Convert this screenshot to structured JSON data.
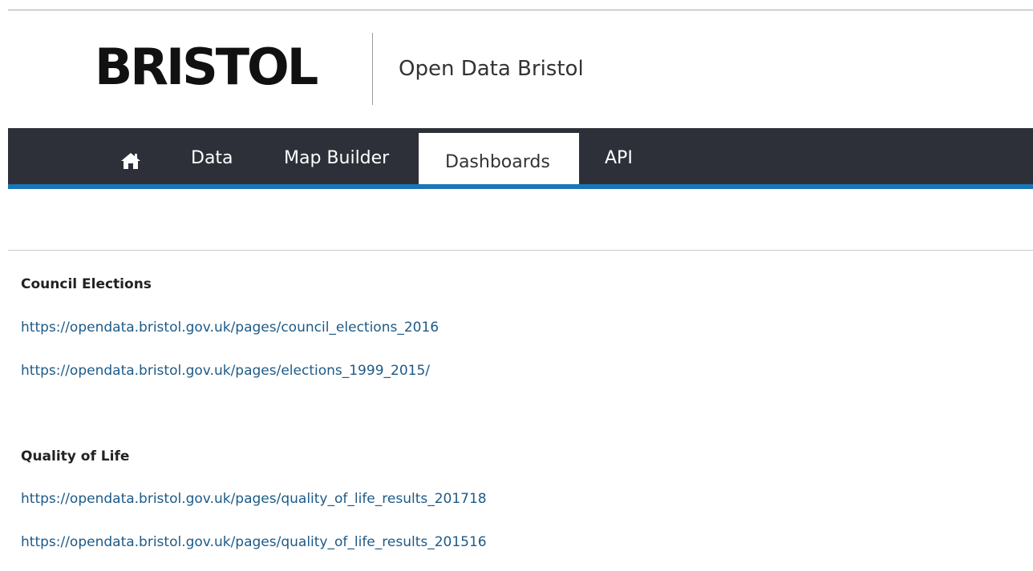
{
  "header": {
    "logo_text": "BRISTOL",
    "site_name": "Open Data Bristol"
  },
  "nav": {
    "home_icon": "home-icon",
    "items": [
      {
        "label": "Data"
      },
      {
        "label": "Map Builder"
      },
      {
        "label": "Dashboards",
        "active": true
      },
      {
        "label": "API"
      }
    ]
  },
  "sections": [
    {
      "title": "Council Elections",
      "links": [
        "https://opendata.bristol.gov.uk/pages/council_elections_2016",
        "https://opendata.bristol.gov.uk/pages/elections_1999_2015/"
      ]
    },
    {
      "title": "Quality of Life",
      "links": [
        "https://opendata.bristol.gov.uk/pages/quality_of_life_results_201718",
        "https://opendata.bristol.gov.uk/pages/quality_of_life_results_201516"
      ]
    }
  ],
  "colors": {
    "nav_background": "#2e3039",
    "nav_accent": "#1976b7",
    "link": "#1d5a87"
  }
}
